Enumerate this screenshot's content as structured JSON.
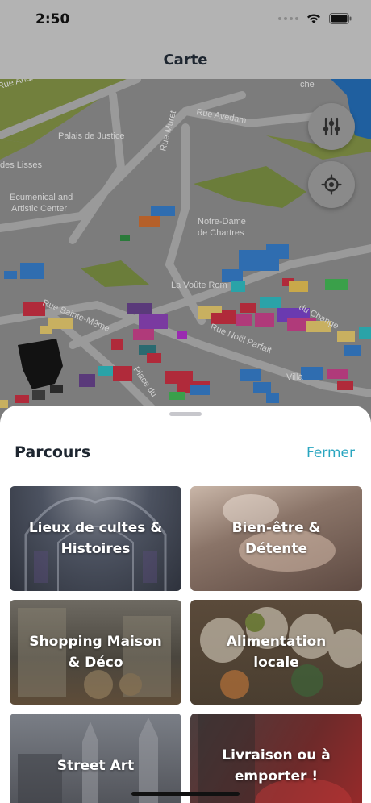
{
  "status": {
    "time": "2:50"
  },
  "nav": {
    "title": "Carte"
  },
  "map": {
    "labels": {
      "street_top": "Rue André Gagnon",
      "rue_avedam": "Rue Avedam",
      "rue_muret": "Rue Muret",
      "palais": "Palais de Justice",
      "des_lisses": "des Lisses",
      "ecumenical_1": "Ecumenical and",
      "ecumenical_2": "Artistic Center",
      "notre_dame_1": "Notre-Dame",
      "notre_dame_2": "de Chartres",
      "voute": "La Voûte Rom",
      "sainte_meme": "Rue Sainte-Même",
      "noel_parfait": "Rue Noël Parfait",
      "place_du": "Place du",
      "villa": "Villa",
      "che": "che",
      "du_change": "du Change"
    },
    "buttons": {
      "filter_icon": "sliders-icon",
      "locate_icon": "locate-icon"
    }
  },
  "sheet": {
    "title": "Parcours",
    "close_label": "Fermer",
    "cards": [
      {
        "label": "Lieux de cultes & Histoires"
      },
      {
        "label": "Bien-être & Détente"
      },
      {
        "label": "Shopping Maison & Déco"
      },
      {
        "label": "Alimentation locale"
      },
      {
        "label": "Street Art"
      },
      {
        "label": "Livraison ou à emporter !"
      }
    ]
  }
}
